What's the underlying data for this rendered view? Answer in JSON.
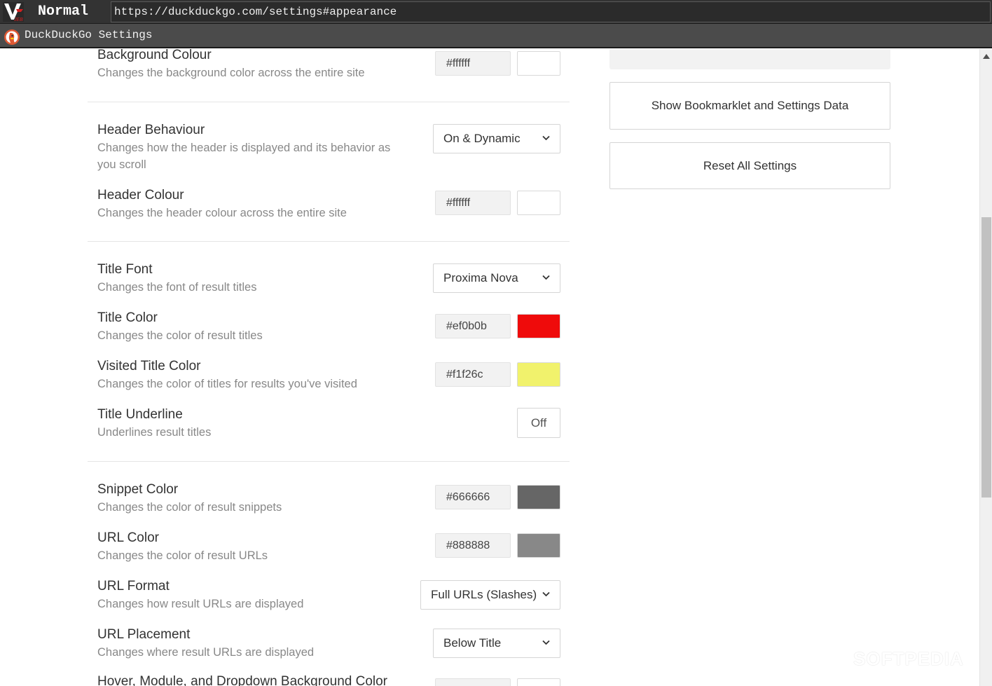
{
  "browser": {
    "mode": "Normal",
    "url": "https://duckduckgo.com/settings#appearance",
    "tab_title": "DuckDuckGo Settings"
  },
  "settings": {
    "background_colour": {
      "label": "Background Colour",
      "description": "Changes the background color across the entire site",
      "value": "#ffffff",
      "swatch": "#ffffff"
    },
    "header_behaviour": {
      "label": "Header Behaviour",
      "description": "Changes how the header is displayed and its behavior as you scroll",
      "value": "On & Dynamic"
    },
    "header_colour": {
      "label": "Header Colour",
      "description": "Changes the header colour across the entire site",
      "value": "#ffffff",
      "swatch": "#ffffff"
    },
    "title_font": {
      "label": "Title Font",
      "description": "Changes the font of result titles",
      "value": "Proxima Nova"
    },
    "title_color": {
      "label": "Title Color",
      "description": "Changes the color of result titles",
      "value": "#ef0b0b",
      "swatch": "#ef0b0b"
    },
    "visited_title_color": {
      "label": "Visited Title Color",
      "description": "Changes the color of titles for results you've visited",
      "value": "#f1f26c",
      "swatch": "#f1f26c"
    },
    "title_underline": {
      "label": "Title Underline",
      "description": "Underlines result titles",
      "value": "Off"
    },
    "snippet_color": {
      "label": "Snippet Color",
      "description": "Changes the color of result snippets",
      "value": "#666666",
      "swatch": "#666666"
    },
    "url_color": {
      "label": "URL Color",
      "description": "Changes the color of result URLs",
      "value": "#888888",
      "swatch": "#888888"
    },
    "url_format": {
      "label": "URL Format",
      "description": "Changes how result URLs are displayed",
      "value": "Full URLs (Slashes)"
    },
    "url_placement": {
      "label": "URL Placement",
      "description": "Changes where result URLs are displayed",
      "value": "Below Title"
    },
    "hover_bg_color": {
      "label": "Hover, Module, and Dropdown Background Color"
    }
  },
  "sidebar": {
    "show_bookmarklet_label": "Show Bookmarklet and Settings Data",
    "reset_label": "Reset All Settings"
  },
  "watermark": "SOFTPEDIA"
}
